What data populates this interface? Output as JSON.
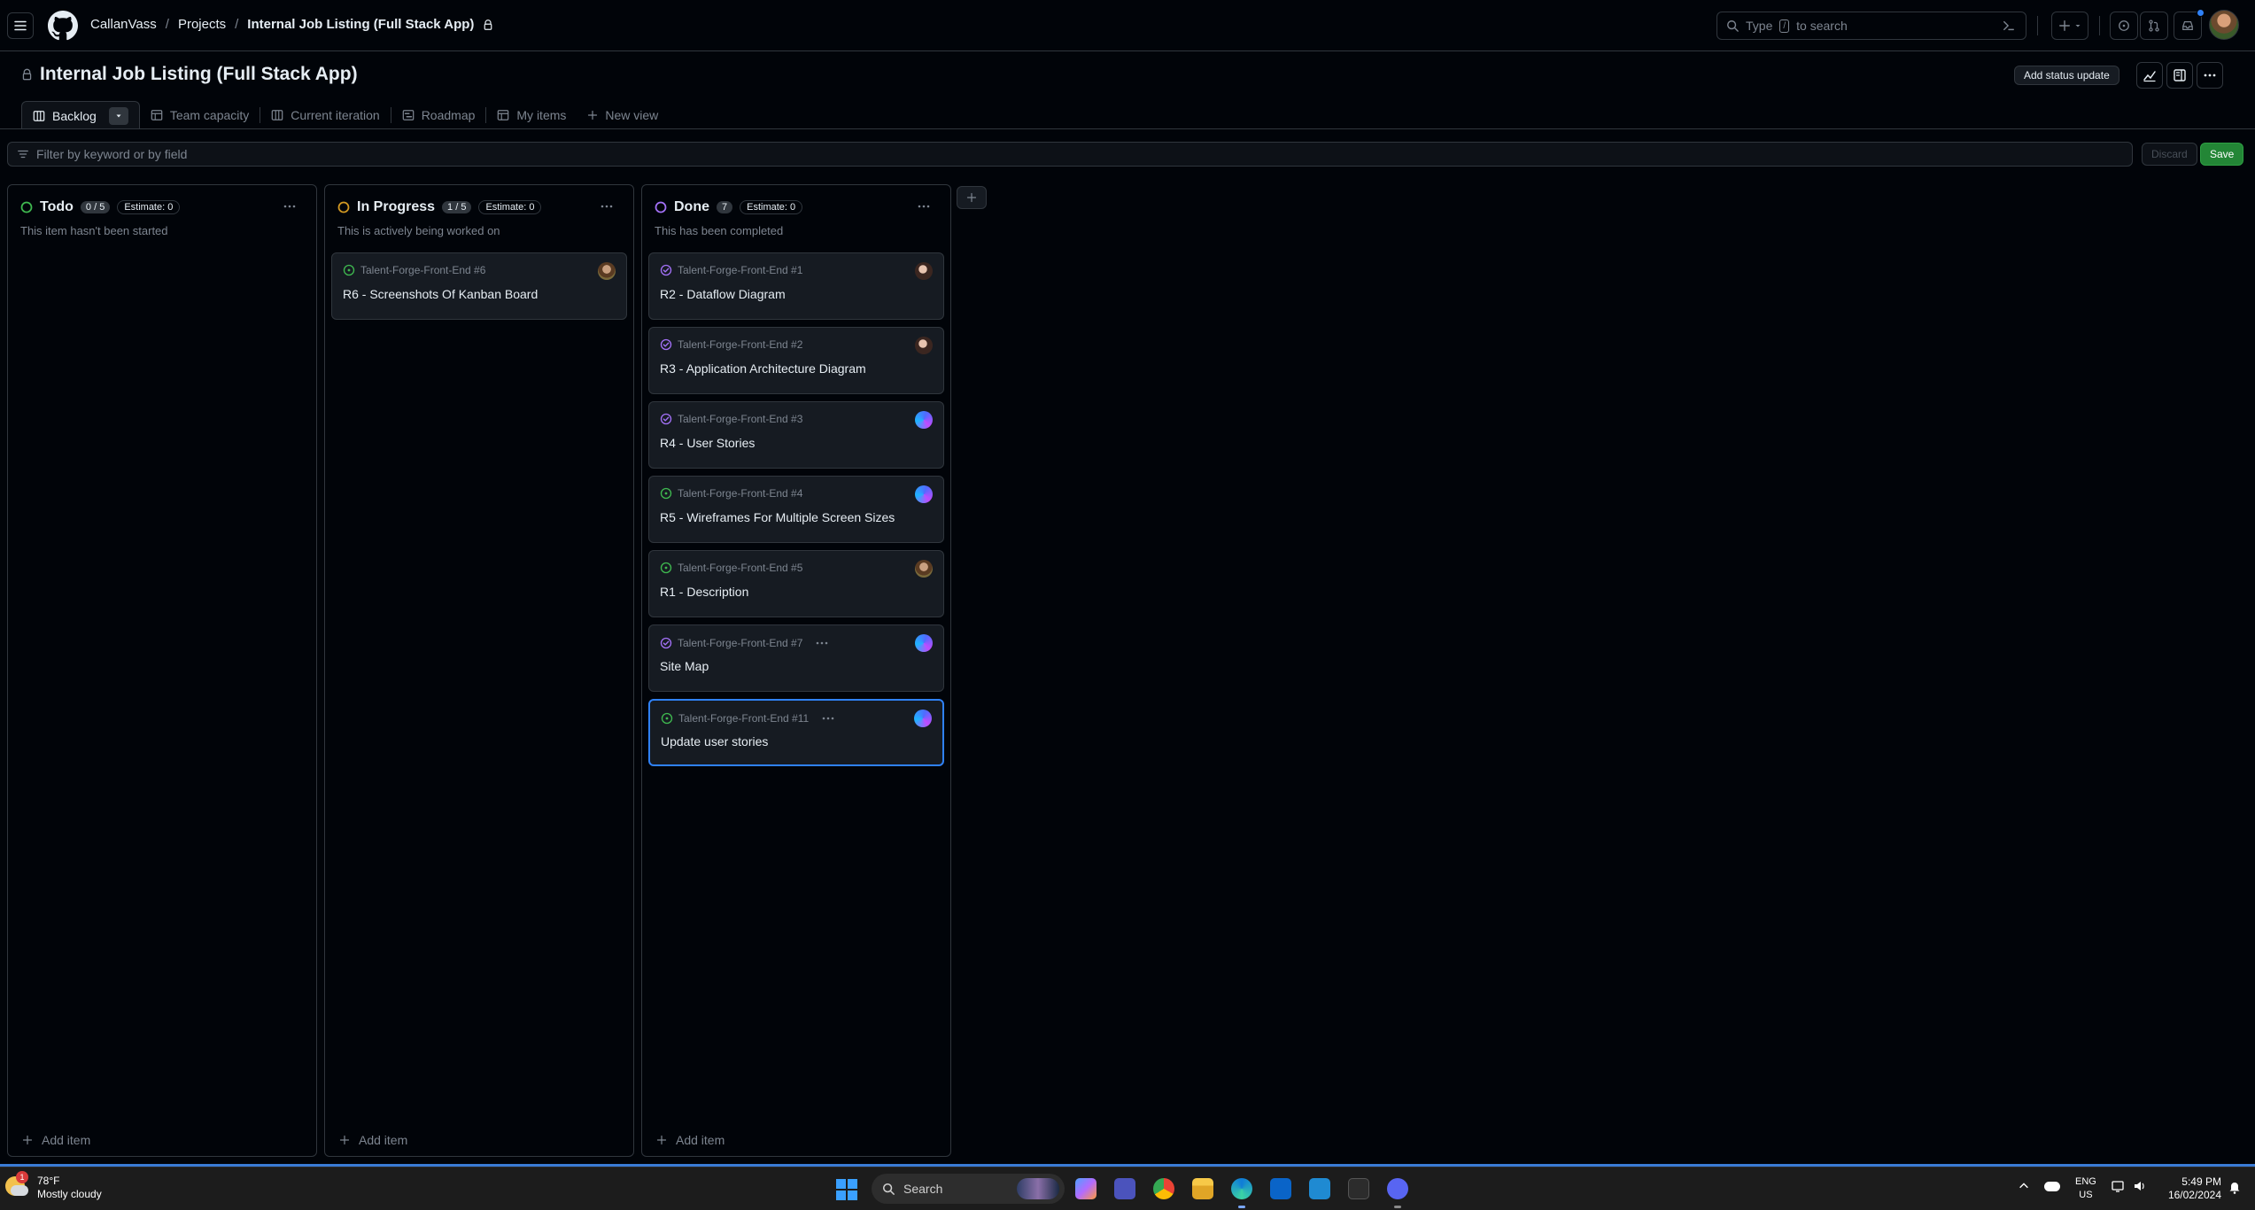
{
  "header": {
    "breadcrumb": {
      "owner": "CallanVass",
      "projects": "Projects",
      "project": "Internal Job Listing (Full Stack App)"
    },
    "search": {
      "prefix": "Type",
      "key": "/",
      "suffix": "to search"
    }
  },
  "project": {
    "title": "Internal Job Listing (Full Stack App)",
    "status_button": "Add status update"
  },
  "views": {
    "tabs": [
      {
        "label": "Backlog",
        "icon": "board-icon",
        "active": true
      },
      {
        "label": "Team capacity",
        "icon": "table-icon"
      },
      {
        "label": "Current iteration",
        "icon": "board-icon"
      },
      {
        "label": "Roadmap",
        "icon": "roadmap-icon"
      },
      {
        "label": "My items",
        "icon": "table-icon"
      },
      {
        "label": "New view",
        "icon": "plus-icon"
      }
    ]
  },
  "filter": {
    "placeholder": "Filter by keyword or by field",
    "discard": "Discard",
    "save": "Save"
  },
  "board": {
    "add_item_label": "Add item",
    "columns": [
      {
        "title": "Todo",
        "count": "0 / 5",
        "estimate": "Estimate: 0",
        "description": "This item hasn't been started",
        "status_color": "#3fb950",
        "cards": []
      },
      {
        "title": "In Progress",
        "count": "1 / 5",
        "estimate": "Estimate: 0",
        "description": "This is actively being worked on",
        "status_color": "#d29922",
        "cards": [
          {
            "ref": "Talent-Forge-Front-End #6",
            "title": "R6 - Screenshots Of Kanban Board",
            "state": "open"
          }
        ]
      },
      {
        "title": "Done",
        "count": "7",
        "estimate": "Estimate: 0",
        "description": "This has been completed",
        "status_color": "#a371f7",
        "cards": [
          {
            "ref": "Talent-Forge-Front-End #1",
            "title": "R2 - Dataflow Diagram",
            "state": "closed"
          },
          {
            "ref": "Talent-Forge-Front-End #2",
            "title": "R3 - Application Architecture Diagram",
            "state": "closed"
          },
          {
            "ref": "Talent-Forge-Front-End #3",
            "title": "R4 - User Stories",
            "state": "closed"
          },
          {
            "ref": "Talent-Forge-Front-End #4",
            "title": "R5 - Wireframes For Multiple Screen Sizes",
            "state": "open"
          },
          {
            "ref": "Talent-Forge-Front-End #5",
            "title": "R1 - Description",
            "state": "open"
          },
          {
            "ref": "Talent-Forge-Front-End #7",
            "title": "Site Map",
            "state": "closed"
          },
          {
            "ref": "Talent-Forge-Front-End #11",
            "title": "Update user stories",
            "state": "open",
            "selected": true
          }
        ]
      }
    ]
  },
  "taskbar": {
    "weather": {
      "temp": "78°F",
      "condition": "Mostly cloudy",
      "badge": "1"
    },
    "search_label": "Search",
    "lang": {
      "line1": "ENG",
      "line2": "US"
    },
    "clock": {
      "time": "5:49 PM",
      "date": "16/02/2024"
    }
  },
  "colors": {
    "accent": "#2f81f7",
    "open_state": "#3fb950",
    "closed_state": "#a371f7",
    "save": "#238636"
  }
}
